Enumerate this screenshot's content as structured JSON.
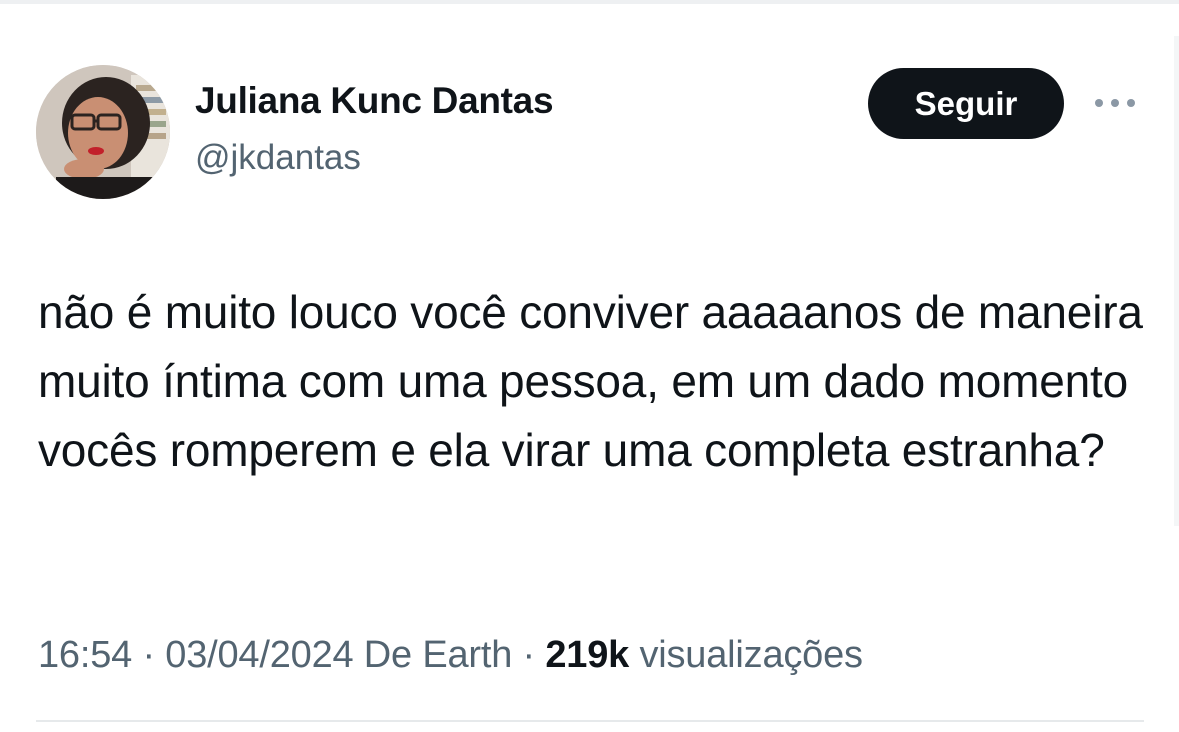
{
  "author": {
    "display_name": "Juliana Kunc Dantas",
    "handle": "@jkdantas"
  },
  "actions": {
    "follow_label": "Seguir",
    "more_icon": "more-horizontal-icon"
  },
  "tweet": {
    "text": "não é muito louco você conviver aaaaanos de maneira muito íntima com uma pessoa, em um dado momento vocês romperem e ela virar uma completa estranha?"
  },
  "meta": {
    "time": "16:54",
    "separator_1": " · ",
    "date": "03/04/2024",
    "source": " De Earth",
    "separator_2": " · ",
    "views_count": "219k",
    "views_label": " visualizações"
  },
  "colors": {
    "text_primary": "#0f1419",
    "text_secondary": "#536471",
    "button_bg": "#0f1419",
    "button_text": "#ffffff"
  }
}
